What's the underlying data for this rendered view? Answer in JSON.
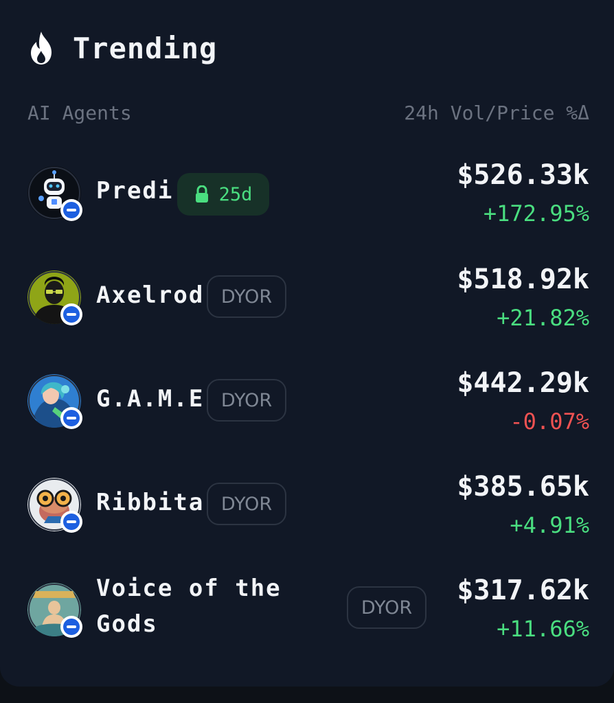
{
  "header": {
    "icon": "flame-icon",
    "title": "Trending"
  },
  "columns": {
    "left": "AI Agents",
    "right": "24h Vol/Price %Δ"
  },
  "agents": [
    {
      "name": "Predi",
      "tag_type": "lock",
      "tag": "25d",
      "volume": "$526.33k",
      "change": "+172.95%",
      "trend": "up",
      "avatar_icon": "robot-avatar-icon"
    },
    {
      "name": "Axelrod",
      "tag_type": "dyor",
      "tag": "DYOR",
      "volume": "$518.92k",
      "change": "+21.82%",
      "trend": "up",
      "avatar_icon": "man-with-glasses-avatar-icon"
    },
    {
      "name": "G.A.M.E",
      "tag_type": "dyor",
      "tag": "DYOR",
      "volume": "$442.29k",
      "change": "-0.07%",
      "trend": "down",
      "avatar_icon": "anime-character-avatar-icon"
    },
    {
      "name": "Ribbita",
      "tag_type": "dyor",
      "tag": "DYOR",
      "volume": "$385.65k",
      "change": "+4.91%",
      "trend": "up",
      "avatar_icon": "frog-with-glasses-avatar-icon"
    },
    {
      "name": "Voice of the Gods",
      "tag_type": "dyor",
      "tag": "DYOR",
      "volume": "$317.62k",
      "change": "+11.66%",
      "trend": "up",
      "avatar_icon": "greek-god-avatar-icon"
    }
  ],
  "colors": {
    "background": "#111826",
    "positive": "#4ade80",
    "negative": "#f05252",
    "chain_badge": "#1d5fe0"
  }
}
